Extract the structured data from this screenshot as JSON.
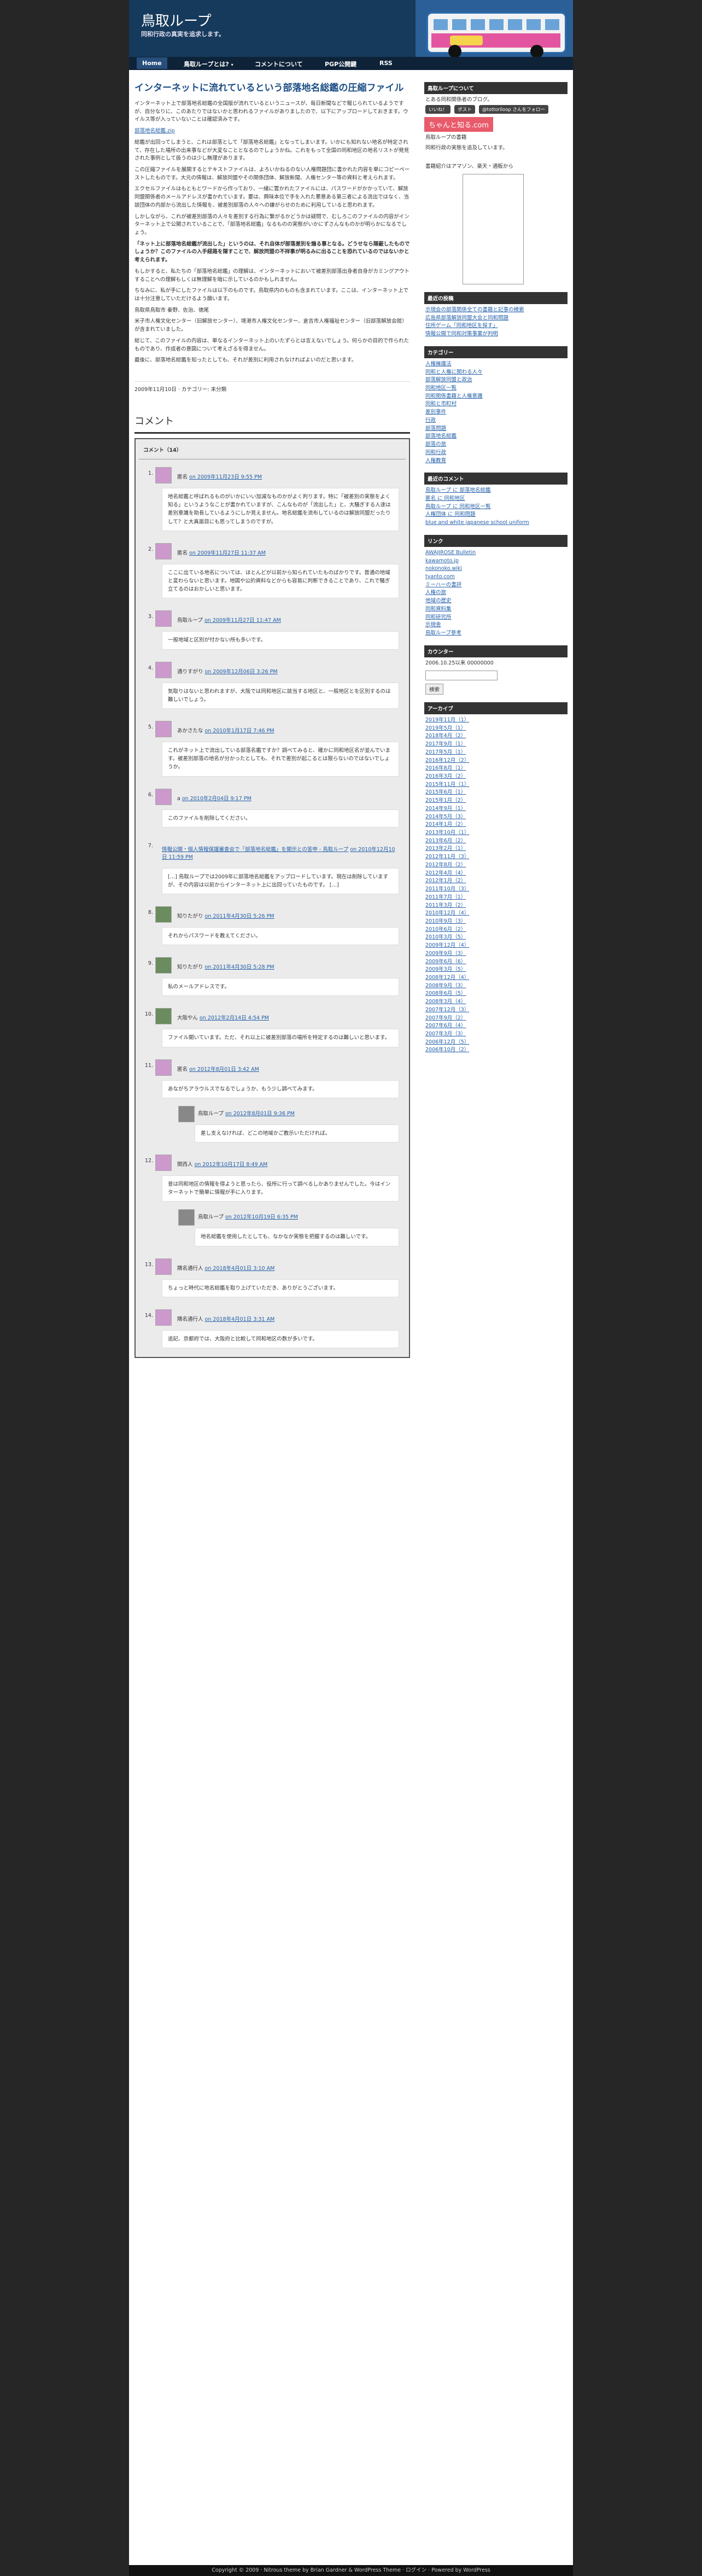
{
  "site": {
    "title": "鳥取ループ",
    "description": "同和行政の真実を追求します。"
  },
  "nav": [
    {
      "label": "Home",
      "active": true
    },
    {
      "label": "鳥取ループとは?",
      "arrow": "▾"
    },
    {
      "label": "コメントについて"
    },
    {
      "label": "PGP公開鍵"
    },
    {
      "label": "RSS"
    }
  ],
  "post": {
    "title": "インターネットに流れているという部落地名総鑑の圧縮ファイル",
    "paragraphs": [
      "インターネット上で部落地名総鑑の全国版が流れているというニュースが、毎日新聞などで報じられているようですが、自分なりに、このあたりではないかと思われるファイルがありましたので、以下にアップロードしておきます。ウイルス等が入っていないことは確認済みです。",
      "部落地名総鑑.zip",
      "総鑑が出回ってしまうと、これは部落として「部落地名総鑑」となってしまいます。いかにも知れない地名が特定されて、存在した場所の出来事などが大変なこととなるのでしょうかね。これをもって全国の同和地区の地名リストが発見された事例として扱うのは少し無理があります。",
      "この圧縮ファイルを展開するとテキストファイルは、よろいかねるのない人権問題団に書かれた内容を単にコピーペーストしたものです。大元の情報は、解放同盟やその関係団体、解放新聞、人権センター等の資料と考えられます。",
      "エクセルファイルはもともとワードから作っており、一緒に置かれたファイルには、パスワードがかかっていて、解放同盟関係者のメールアドレスが書かれています。要は、興味本位で手を入れた悪意ある第三者による流出ではなく、当該団体の内部から流出した情報を、被差別部落の人々への嫌がらせのために利用していると思われます。",
      "しかしながら、これが被差別部落の人々を差別する行為に繋がるかどうかは疑問で、むしろこのファイルの内容がインターネット上で公開されていることで、「部落地名総鑑」なるものの実態がいかにずさんなものかが明らかになるでしょう。",
      "「ネット上に部落地名総鑑が流出した」というのは、それ自体が部落差別を煽る事となる。どうせなら隠蔽したものでしょうか？このファイルの入手経路を隠すことで、解放同盟の不祥事が明るみに出ることを恐れているのではないかと考えられます。",
      "もしかすると、私たちの「部落地名総鑑」の理解は、インターネットにおいて被差別部落出身者自身がカミングアウトすることへの理解もしくは無理解を暗に示しているのかもしれません。",
      "ちなみに、私が手にしたファイルは以下のものです。鳥取県内のものも含まれています。ここは、インターネット上では十分注意していただけるよう願います。",
      "鳥取県鳥取市 秦野、佐治、徳尾",
      "米子市人権文化センター（旧解放センター）、境港市人権文化センター、倉吉市人権福祉センター（旧部落解放会館）が含まれていました。",
      "総じて、このファイルの内容は、単なるインターネット上のいたずらとは言えないでしょう。何らかの目的で作られたものであり、作成者の意図について考えざるを得ません。",
      "最後に、部落地名総鑑を知ったとしても、それが差別に利用されなければよいのだと思います。"
    ],
    "meta": "2009年11月10日 · カテゴリー: 未分類"
  },
  "comments_title": "コメント",
  "comments_count_label": "コメント（14）",
  "comments": [
    {
      "num": "1.",
      "author": "匿名",
      "date": "on 2009年11月23日 9:55 PM",
      "avatar": "pink",
      "body": "地名総鑑と呼ばれるものがいかにいい加減なものかがよく判ります。特に「被差別の実態をよく知る」というようなことが書かれていますが、こんなものが「流出した」と、大騒ぎする人達は差別意識を助長しているようにしか見えません。地名総鑑を流布しているのは解放同盟だったりして？と大真面目にも思ってしまうのですが。"
    },
    {
      "num": "2.",
      "author": "匿名",
      "date": "on 2009年11月27日 11:37 AM",
      "avatar": "pink",
      "body": "ここに出ている地名については、ほとんどが以前から知られていたものばかりです。普通の地域と変わらないと思います。地図や公的資料などからも容易に判断できることであり、これで騒ぎ立てるのはおかしいと思います。"
    },
    {
      "num": "3.",
      "author": "鳥取ループ",
      "date": "on 2009年11月27日 11:47 AM",
      "avatar": "pink",
      "body": "一般地域と区別が付かない所も多いです。"
    },
    {
      "num": "4.",
      "author": "通りすがり",
      "date": "on 2009年12月06日 3:26 PM",
      "avatar": "pink",
      "body": "気取りはないと思われますが、大阪では同和地区に該当する地区と、一般地区とを区別するのは難しいでしょう。"
    },
    {
      "num": "5.",
      "author": "あかさたな",
      "date": "on 2010年1月17日 7:46 PM",
      "avatar": "pink",
      "body": "これがネット上で流出している部落名鑑ですか？調べてみると、確かに同和地区名が並んでいます。被差別部落の地名が分かったとしても、それで差別が起こるとは限らないのではないでしょうか。"
    },
    {
      "num": "6.",
      "author": "a",
      "date": "on 2010年2月04日 9:17 PM",
      "avatar": "pink",
      "body": "このファイルを削除してください。"
    },
    {
      "num": "7.",
      "author": "",
      "date": "on 2010年12月10日 11:59 PM",
      "avatar": "none",
      "link": "情報公開・個人情報保護審査会で「部落地名総鑑」を開示との答申 - 鳥取ループ",
      "body": "[…] 鳥取ループでは2009年に部落地名総鑑をアップロードしています。現在は削除していますが、その内容は以前からインターネット上に出回っていたものです。 […]"
    },
    {
      "num": "8.",
      "author": "知りたがり",
      "date": "on 2011年4月30日 5:26 PM",
      "avatar": "pic",
      "body": "それからパスワードを教えてください。"
    },
    {
      "num": "9.",
      "author": "知りたがり",
      "date": "on 2011年4月30日 5:28 PM",
      "avatar": "pic",
      "body": "私のメールアドレスです。"
    },
    {
      "num": "10.",
      "author": "大阪やん",
      "date": "on 2012年2月14日 4:54 PM",
      "avatar": "pic",
      "body": "ファイル開いています。ただ、それ以上に被差別部落の場所を特定するのは難しいと思います。"
    },
    {
      "num": "11.",
      "author": "匿名",
      "date": "on 2012年8月01日 3:42 AM",
      "avatar": "pink",
      "body": "あながちアラウルスでなるでしょうか、もう少し調べてみます。",
      "reply": {
        "author": "鳥取ループ",
        "date": "on 2012年8月01日 9:36 PM",
        "body": "差し支えなければ、どこの地域かご教示いただければ。"
      }
    },
    {
      "num": "12.",
      "author": "関西人",
      "date": "on 2012年10月17日 8:49 AM",
      "avatar": "pink",
      "body": "昔は同和地区の情報を得ようと思ったら、役所に行って調べるしかありませんでした。今はインターネットで簡単に情報が手に入ります。",
      "reply": {
        "author": "鳥取ループ",
        "date": "on 2012年10月19日 6:35 PM",
        "body": "地名総鑑を使用したとしても、なかなか実態を把握するのは難しいです。"
      }
    },
    {
      "num": "13.",
      "author": "隣名通行人",
      "date": "on 2018年4月01日 3:10 AM",
      "avatar": "pink",
      "body": "ちょっと時代に地名総鑑を取り上げていただき、ありがとうございます。"
    },
    {
      "num": "14.",
      "author": "隣名通行人",
      "date": "on 2018年4月01日 3:31 AM",
      "avatar": "pink",
      "body": "追記、京都府では、大阪府と比較して同和地区の数が多いです。"
    }
  ],
  "sidebar": {
    "about_head": "鳥取ループについて",
    "about_text": "とある同和関係者のブログ。",
    "btn1": "いいね！",
    "btn2": "ポスト",
    "follow": "@tottoriloop さんをフォロー",
    "promo": "ちゃんと知る.com",
    "promo_sub": "鳥取ループの書籍",
    "links_text": "同和行政の実態を追及しています。",
    "ad_note": "書籍紹介はアマゾン、楽天・通販から",
    "recent_head": "最近の投稿",
    "recent": [
      "示現会の部落関係全ての書籍と記事の検索",
      "広島県部落解放同盟大会と同和問題",
      "住所ゲーム「同和地区を探す」",
      "情報公開で同和対策事業が判明"
    ],
    "cat_head": "カテゴリー",
    "cats": [
      "人権擁護法",
      "同和と人権に関わる人々",
      "部落解放同盟と政治",
      "同和地区一覧",
      "同和関係書籍と人権意識",
      "同和と市町村",
      "差別事件",
      "行政",
      "部落問題",
      "部落地名総鑑",
      "部落の旅",
      "同和行政",
      "人権教育"
    ],
    "rc_head": "最近のコメント",
    "rc": [
      "鳥取ループ に 部落地名総鑑",
      "匿名 に 同和地区",
      "鳥取ループ に 同和地区一覧",
      "人権団体 に 同和問題",
      "blue and white japanese school uniform"
    ],
    "link_head": "リンク",
    "links": [
      "AWAJIROSE Bulletin",
      "kawamoto.jp",
      "nokonoko.wiki",
      "tyanto.com",
      "ミーハーの書評",
      "人権の旅",
      "地域の歴史",
      "同和資料集",
      "同和研究所",
      "示現舎",
      "鳥取ループ参考"
    ],
    "counter_head": "カウンター",
    "counter": "2006.10.25以来 00000000",
    "search_label": "検索",
    "archive_head": "アーカイブ",
    "archives": [
      "2019年11月（1）",
      "2019年5月（1）",
      "2018年4月（2）",
      "2017年9月（1）",
      "2017年5月（1）",
      "2016年12月（2）",
      "2016年8月（1）",
      "2016年3月（2）",
      "2015年11月（1）",
      "2015年6月（1）",
      "2015年1月（2）",
      "2014年9月（1）",
      "2014年5月（3）",
      "2014年1月（2）",
      "2013年10月（1）",
      "2013年6月（2）",
      "2013年2月（1）",
      "2012年11月（3）",
      "2012年8月（2）",
      "2012年4月（4）",
      "2012年1月（2）",
      "2011年10月（3）",
      "2011年7月（1）",
      "2011年3月（2）",
      "2010年12月（4）",
      "2010年9月（3）",
      "2010年6月（2）",
      "2010年3月（5）",
      "2009年12月（4）",
      "2009年9月（3）",
      "2009年6月（6）",
      "2009年3月（5）",
      "2008年12月（4）",
      "2008年9月（3）",
      "2008年6月（5）",
      "2008年3月（4）",
      "2007年12月（3）",
      "2007年9月（2）",
      "2007年6月（4）",
      "2007年3月（3）",
      "2006年12月（5）",
      "2006年10月（2）"
    ]
  },
  "footer": "Copyright © 2009 · Nitrous theme by Brian Gardner & WordPress Theme · ログイン · Powered by WordPress"
}
